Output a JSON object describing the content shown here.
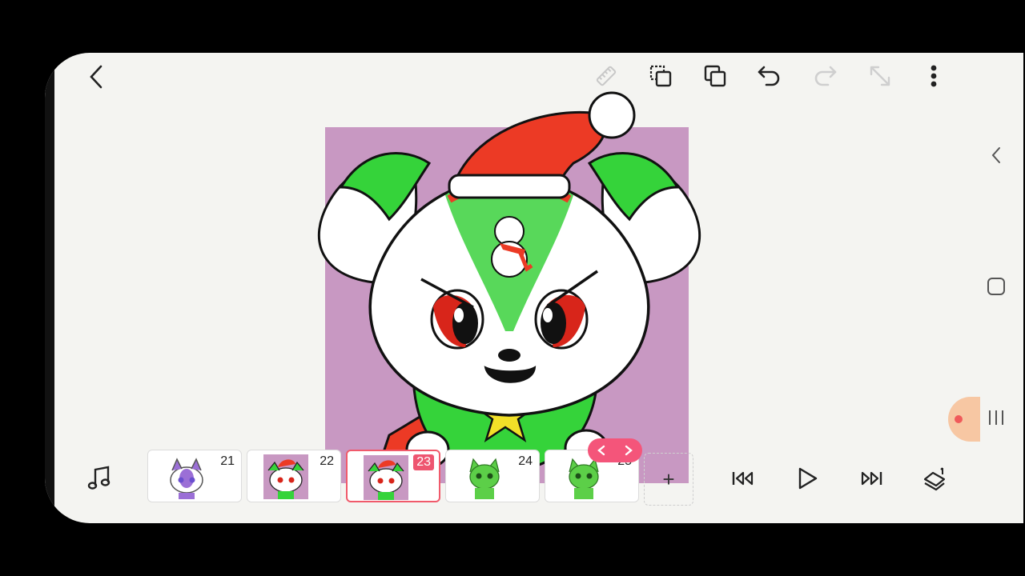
{
  "toolbar": {
    "back_icon": "chevron-left-icon",
    "icons": [
      "ruler-icon",
      "copy-layer-icon",
      "duplicate-icon",
      "undo-icon",
      "redo-icon",
      "resize-icon",
      "more-vert-icon"
    ]
  },
  "system_nav": {
    "items": [
      "back-chevron-icon",
      "home-square-icon",
      "recents-icon"
    ]
  },
  "frames": [
    {
      "number": "21",
      "thumb": "purple-fox",
      "selected": false
    },
    {
      "number": "22",
      "thumb": "santa-fox",
      "selected": false
    },
    {
      "number": "23",
      "thumb": "santa-fox",
      "selected": true
    },
    {
      "number": "24",
      "thumb": "green-cat",
      "selected": false
    },
    {
      "number": "25",
      "thumb": "green-cat",
      "selected": false
    }
  ],
  "playback": {
    "icons": [
      "music-icon",
      "first-frame-icon",
      "play-icon",
      "last-frame-icon",
      "layers-icon"
    ]
  },
  "add_frame_label": "+",
  "colors": {
    "accent": "#f05a6b",
    "canvas_bg": "#c898c2",
    "hat_red": "#ec3a25",
    "fox_green": "#35d33a"
  }
}
